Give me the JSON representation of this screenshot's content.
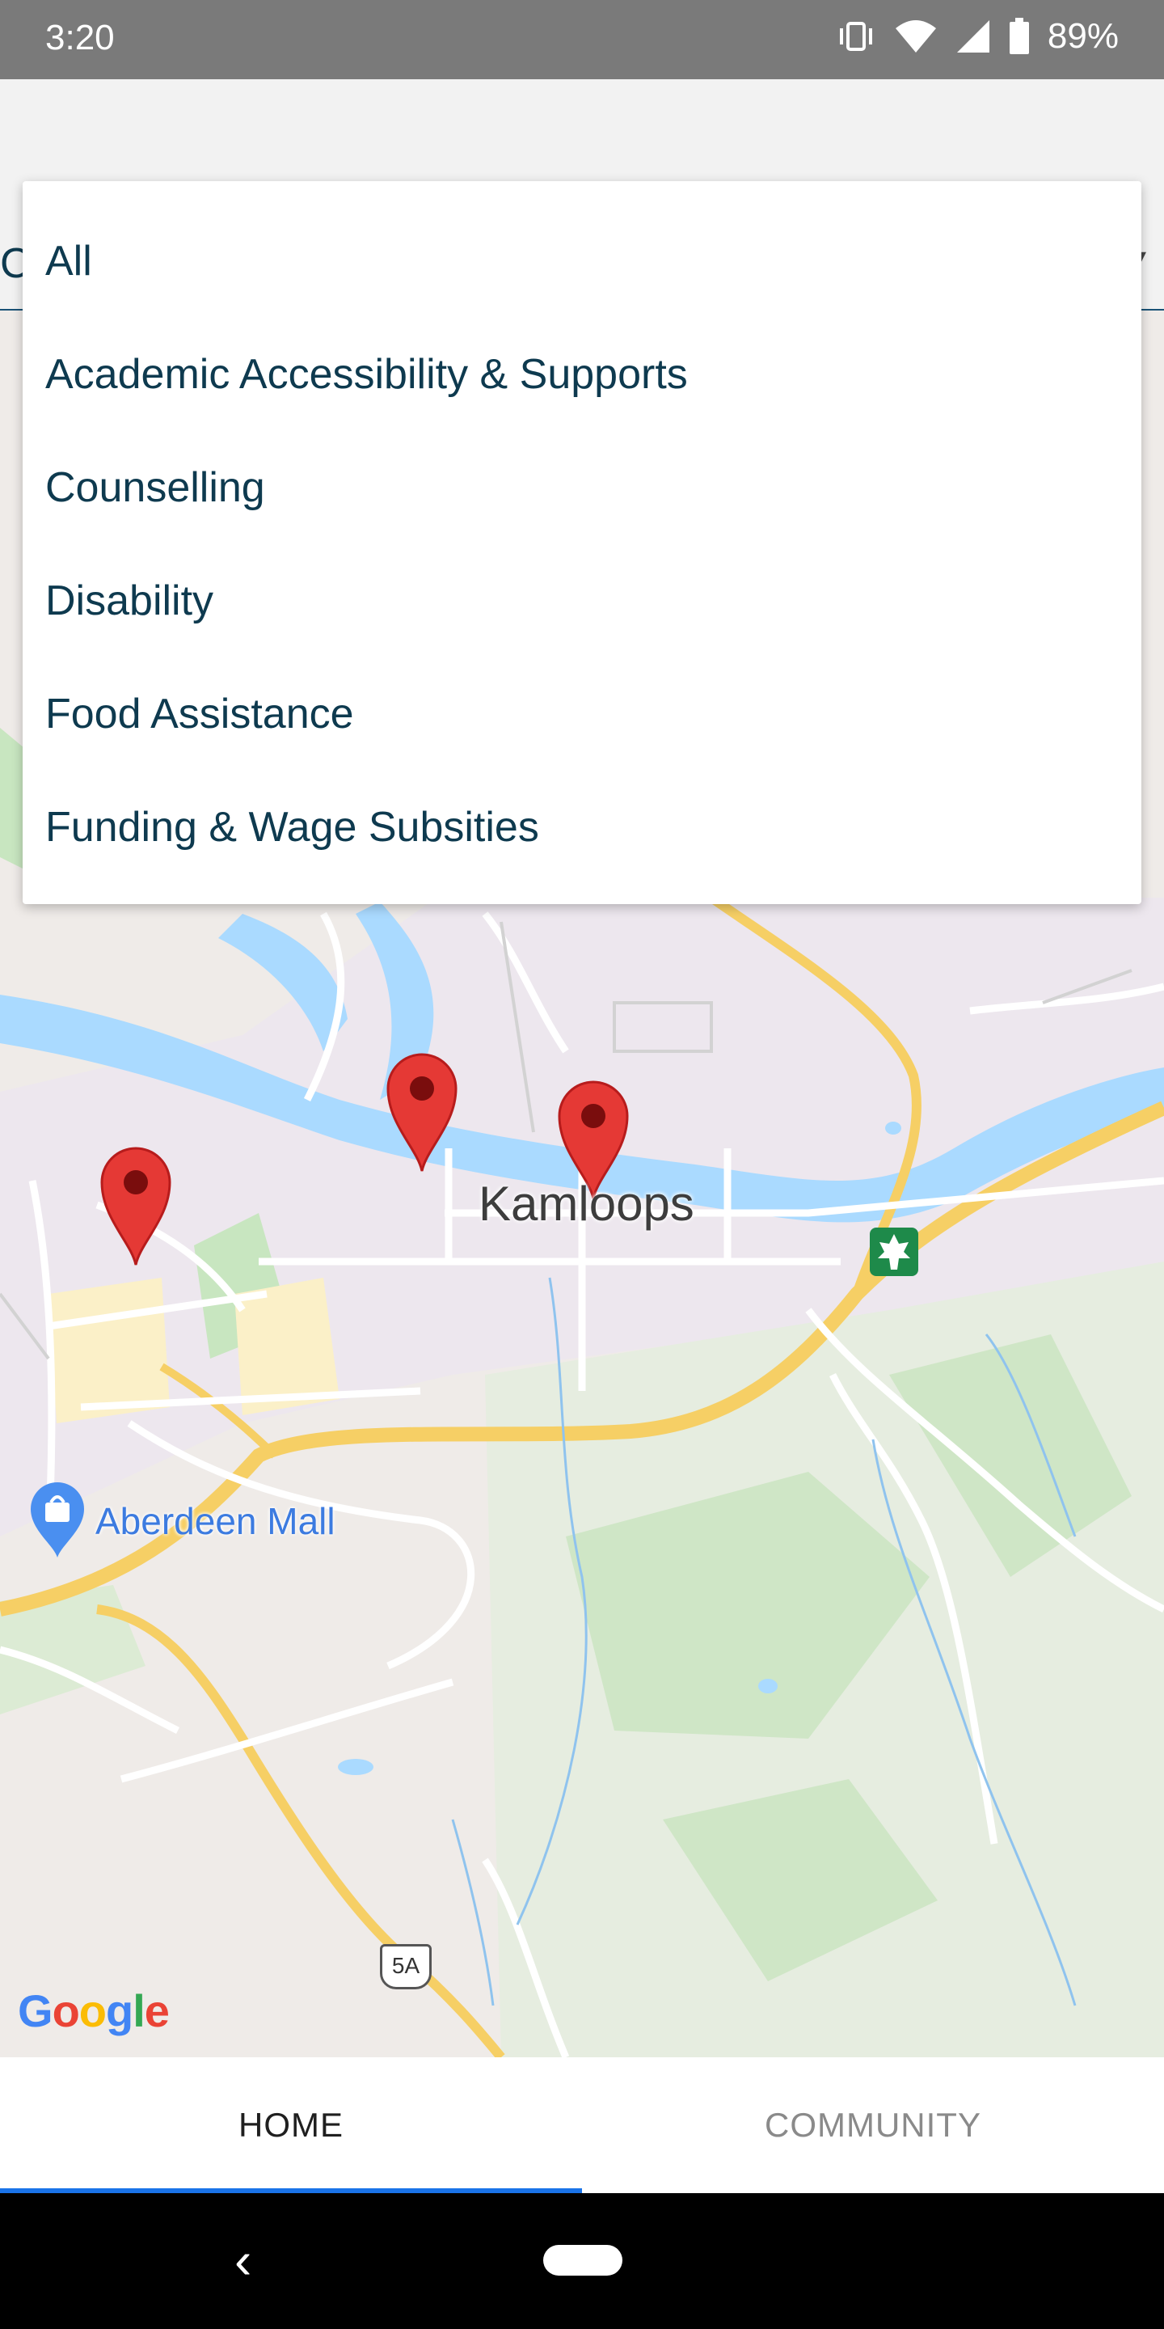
{
  "status_bar": {
    "time": "3:20",
    "battery": "89%",
    "icons": [
      "vibrate-icon",
      "wifi-icon",
      "signal-icon",
      "battery-icon"
    ]
  },
  "filter": {
    "visible_char": "C",
    "options": [
      "All",
      "Academic Accessibility & Supports",
      "Counselling",
      "Disability",
      "Food Assistance",
      "Funding & Wage Subsities"
    ]
  },
  "map": {
    "city_label": "Kamloops",
    "poi_label": "Aberdeen Mall",
    "highway_shield": "5A",
    "google_logo": [
      "G",
      "o",
      "o",
      "g",
      "l",
      "e"
    ],
    "marker_count": 3
  },
  "tabs": {
    "home": "HOME",
    "community": "COMMUNITY"
  },
  "colors": {
    "accent": "#1a73e8",
    "dropdown_text": "#0e3a4f",
    "marker": "#e53935",
    "water": "#aadaff",
    "park": "#c8e6c0",
    "highway": "#f6cf65"
  }
}
